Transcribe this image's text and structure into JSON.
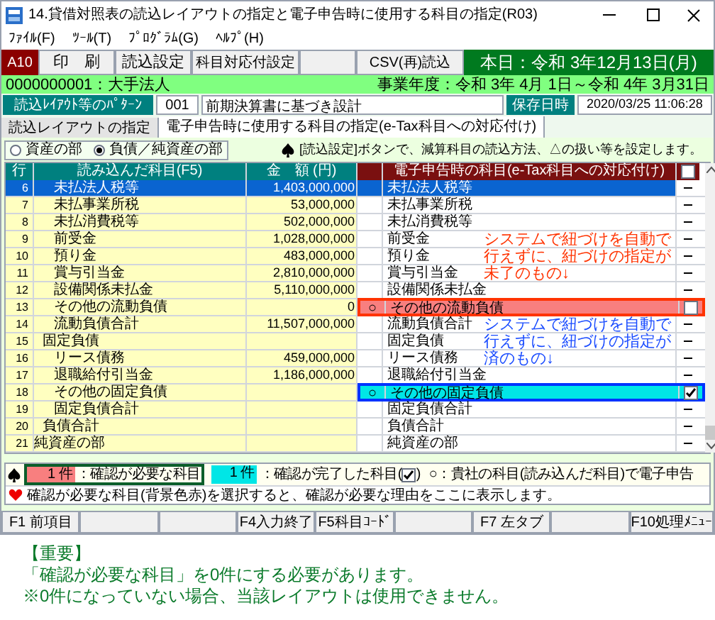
{
  "window": {
    "title": "14.貸借対照表の読込レイアウトの指定と電子申告時に使用する科目の指定(R03)"
  },
  "menu": [
    "ﾌｧｲﾙ(F)",
    "ﾂｰﾙ(T)",
    "ﾌﾟﾛｸﾞﾗﾑ(G)",
    "ﾍﾙﾌﾟ(H)"
  ],
  "toolbar": {
    "code": "A10",
    "buttons": [
      {
        "kind": "button",
        "label": "印　刷"
      },
      {
        "kind": "button",
        "label": "読込設定"
      },
      {
        "kind": "small",
        "label": "科目対応付設定"
      },
      {
        "kind": "blank"
      },
      {
        "kind": "small",
        "label": "CSV(再)読込"
      }
    ],
    "date": "本日：令和 3年12月13日(月)"
  },
  "company": {
    "name": "0000000001：大手法人",
    "fiscal_year": "事業年度：令和 3年 4月 1日～令和 4年 3月31日"
  },
  "pattern": {
    "label": "読込ﾚｲｱｳﾄ等のﾊﾟﾀｰﾝ",
    "code": "001",
    "name": "前期決算書に基づき設計",
    "saved_label": "保存日時",
    "saved": "2020/03/25 11:06:28"
  },
  "tabs": [
    {
      "label": "読込レイアウトの指定",
      "selected": false
    },
    {
      "label": "電子申告時に使用する科目の指定(e-Tax科目への対応付け)",
      "selected": true
    }
  ],
  "radios": [
    {
      "label": "資産の部",
      "selected": false
    },
    {
      "label": "負債／純資産の部",
      "selected": true
    }
  ],
  "hint": "[読込設定]ボタンで、減算科目の読込方法、△の扱い等を設定します。",
  "table": {
    "columns": [
      "行",
      "読み込んだ科目(F5)",
      "金　額 (円)",
      "電子申告時の科目(e-Tax科目への対応付け)"
    ],
    "header_checked": false,
    "rows": [
      {
        "no": "6",
        "kind": "item",
        "name": "未払法人税等",
        "amount": "1,403,000,000",
        "etax": "未払法人税等",
        "selected": true
      },
      {
        "no": "7",
        "kind": "item",
        "name": "未払事業所税",
        "amount": "53,000,000",
        "etax": "未払事業所税",
        "selected": false
      },
      {
        "no": "8",
        "kind": "item",
        "name": "未払消費税等",
        "amount": "502,000,000",
        "etax": "未払消費税等",
        "selected": false
      },
      {
        "no": "9",
        "kind": "item",
        "name": "前受金",
        "amount": "1,028,000,000",
        "etax": "前受金",
        "selected": false
      },
      {
        "no": "10",
        "kind": "item",
        "name": "預り金",
        "amount": "483,000,000",
        "etax": "預り金",
        "selected": false
      },
      {
        "no": "11",
        "kind": "item",
        "name": "賞与引当金",
        "amount": "2,810,000,000",
        "etax": "賞与引当金",
        "selected": false
      },
      {
        "no": "12",
        "kind": "item",
        "name": "設備関係未払金",
        "amount": "5,110,000,000",
        "etax": "設備関係未払金",
        "selected": false
      },
      {
        "no": "13",
        "kind": "item",
        "name": "その他の流動負債",
        "amount": "0",
        "mark": "○",
        "etax": "その他の流動負債",
        "checked": false,
        "selected": false
      },
      {
        "no": "14",
        "kind": "item",
        "name": "流動負債合計",
        "amount": "11,507,000,000",
        "etax": "流動負債合計",
        "selected": false
      },
      {
        "no": "15",
        "kind": "group",
        "name": "固定負債",
        "etax": "固定負債",
        "selected": false
      },
      {
        "no": "16",
        "kind": "item",
        "name": "リース債務",
        "amount": "459,000,000",
        "etax": "リース債務",
        "selected": false
      },
      {
        "no": "17",
        "kind": "item",
        "name": "退職給付引当金",
        "amount": "1,186,000,000",
        "etax": "退職給付引当金",
        "selected": false
      },
      {
        "no": "18",
        "kind": "item",
        "name": "その他の固定負債",
        "mark": "○",
        "etax": "その他の固定負債",
        "checked": true,
        "selected": false
      },
      {
        "no": "19",
        "kind": "item",
        "name": "固定負債合計",
        "etax": "固定負債合計",
        "selected": false
      },
      {
        "no": "20",
        "kind": "group",
        "name": "負債合計",
        "etax": "負債合計",
        "selected": false
      },
      {
        "no": "21",
        "kind": "section",
        "name": "純資産の部",
        "etax": "純資産の部",
        "selected": false
      }
    ]
  },
  "annotations": [
    {
      "kind": "needs",
      "text": "システムで紐づけを自動で行えずに、紐づけの指定が未了のもの↓"
    },
    {
      "kind": "done",
      "text": "システムで紐づけを自動で行えずに、紐づけの指定が済のもの↓"
    }
  ],
  "legend": {
    "needs_count": "1 件",
    "needs_label": "：確認が必要な科目",
    "done_count": "1 件",
    "done_label_before": "：確認が完了した科目(",
    "done_label_after": ")",
    "own_label": "○：貴社の科目(読み込んだ科目)で電子申告",
    "message": "確認が必要な科目(背景色赤)を選択すると、確認が必要な理由をここに表示します。"
  },
  "function_keys": [
    {
      "kind": "key",
      "label": "F1 前項目"
    },
    {
      "kind": "blank"
    },
    {
      "kind": "blank"
    },
    {
      "kind": "key",
      "label": "F4入力終了"
    },
    {
      "kind": "key",
      "label": "F5科目ｺｰﾄﾞ"
    },
    {
      "kind": "blank"
    },
    {
      "kind": "key",
      "label": "F7 左タブ"
    },
    {
      "kind": "blank"
    },
    {
      "kind": "key",
      "label": "F10処理ﾒﾆｭｰ"
    }
  ],
  "notes": [
    "【重要】",
    "「確認が必要な科目」を0件にする必要があります。",
    "※0件になっていない場合、当該レイアウトは使用できません。"
  ]
}
